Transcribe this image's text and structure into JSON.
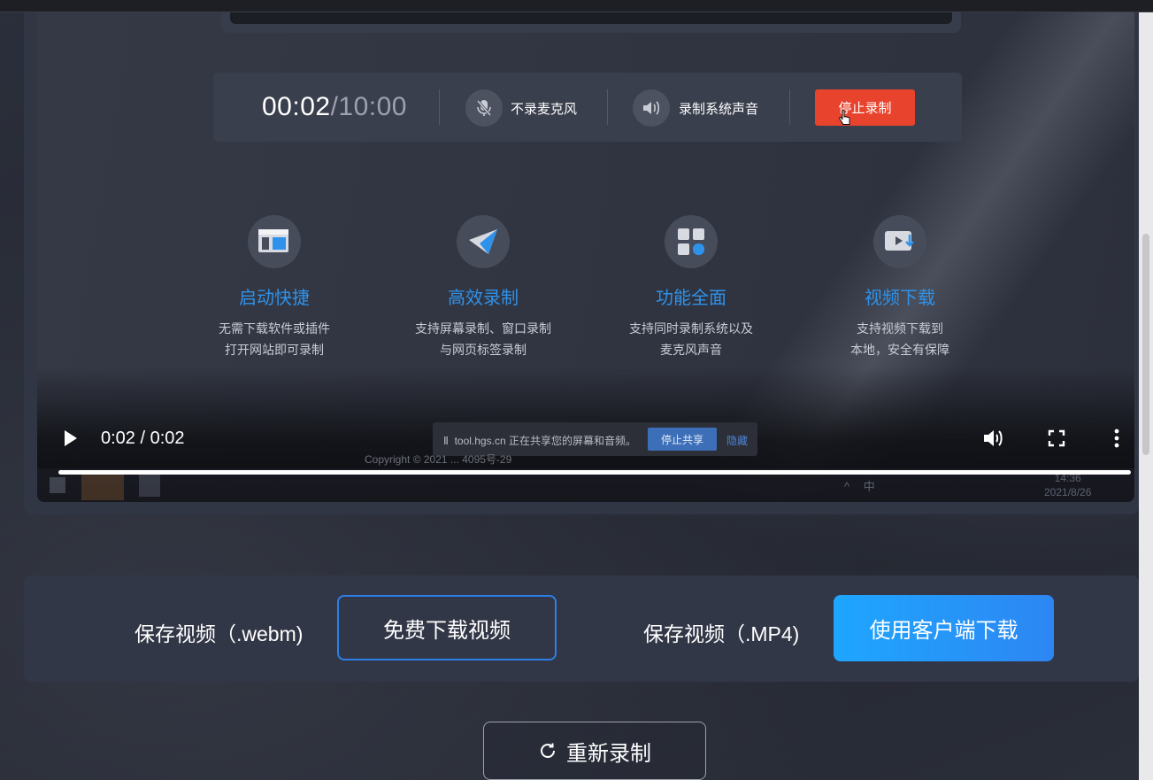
{
  "recorder": {
    "elapsed": "00:02",
    "total": "/10:00",
    "mic_label": "不录麦克风",
    "sound_label": "录制系统声音",
    "stop_label": "停止录制"
  },
  "features": [
    {
      "title": "启动快捷",
      "desc1": "无需下载软件或插件",
      "desc2": "打开网站即可录制",
      "icon": "layout-icon"
    },
    {
      "title": "高效录制",
      "desc1": "支持屏幕录制、窗口录制",
      "desc2": "与网页标签录制",
      "icon": "paper-plane-icon"
    },
    {
      "title": "功能全面",
      "desc1": "支持同时录制系统以及",
      "desc2": "麦克风声音",
      "icon": "grid-icon"
    },
    {
      "title": "视频下载",
      "desc1": "支持视频下载到",
      "desc2": "本地，安全有保障",
      "icon": "video-download-icon"
    }
  ],
  "share_bar": {
    "text": "tool.hgs.cn 正在共享您的屏幕和音频。",
    "stop": "停止共享",
    "hide": "隐藏"
  },
  "copyright": "Copyright © 2021 ... 4095号-29",
  "taskbar": {
    "tray": "^ 中",
    "time": "14:36",
    "date": "2021/8/26"
  },
  "player": {
    "time": "0:02 / 0:02",
    "progress": 1.0
  },
  "save": {
    "webm_label": "保存视频（.webm)",
    "webm_button": "免费下载视频",
    "mp4_label": "保存视频（.MP4)",
    "mp4_button": "使用客户端下载"
  },
  "redo_label": "重新录制",
  "colors": {
    "accent_blue": "#2f92ea",
    "stop_red": "#e8432d",
    "button_gradient_start": "#1ea6ff",
    "button_gradient_end": "#2d86f2"
  }
}
